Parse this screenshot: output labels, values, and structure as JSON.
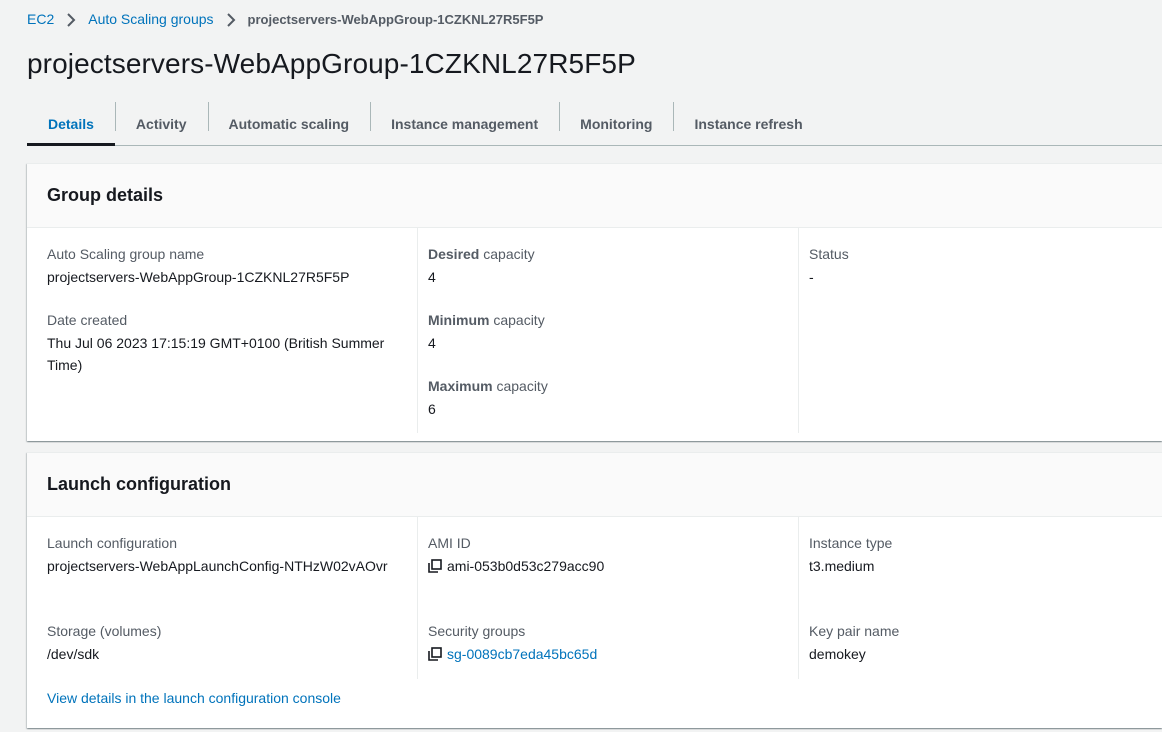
{
  "breadcrumb": {
    "items": [
      "EC2",
      "Auto Scaling groups"
    ],
    "current": "projectservers-WebAppGroup-1CZKNL27R5F5P"
  },
  "title": "projectservers-WebAppGroup-1CZKNL27R5F5P",
  "tabs": [
    "Details",
    "Activity",
    "Automatic scaling",
    "Instance management",
    "Monitoring",
    "Instance refresh"
  ],
  "group_details": {
    "heading": "Group details",
    "asg_name_label": "Auto Scaling group name",
    "asg_name_value": "projectservers-WebAppGroup-1CZKNL27R5F5P",
    "date_created_label": "Date created",
    "date_created_value": "Thu Jul 06 2023 17:15:19 GMT+0100 (British Summer Time)",
    "desired_bold": "Desired",
    "desired_rest": " capacity",
    "desired_value": "4",
    "minimum_bold": "Minimum",
    "minimum_rest": " capacity",
    "minimum_value": "4",
    "maximum_bold": "Maximum",
    "maximum_rest": " capacity",
    "maximum_value": "6",
    "status_label": "Status",
    "status_value": "-"
  },
  "launch_configuration": {
    "heading": "Launch configuration",
    "lc_label": "Launch configuration",
    "lc_value": "projectservers-WebAppLaunchConfig-NTHzW02vAOvr",
    "ami_label": "AMI ID",
    "ami_value": "ami-053b0d53c279acc90",
    "instance_type_label": "Instance type",
    "instance_type_value": "t3.medium",
    "storage_label": "Storage (volumes)",
    "storage_value": "/dev/sdk",
    "security_groups_label": "Security groups",
    "security_groups_value": "sg-0089cb7eda45bc65d",
    "key_pair_label": "Key pair name",
    "key_pair_value": "demokey",
    "view_details_link": "View details in the launch configuration console"
  },
  "colors": {
    "link": "#0073bb",
    "text": "#16191f",
    "muted": "#545b64",
    "background": "#f2f3f3"
  },
  "icons": {
    "breadcrumb_separator": "chevron-right-icon",
    "copy": "copy-icon"
  }
}
